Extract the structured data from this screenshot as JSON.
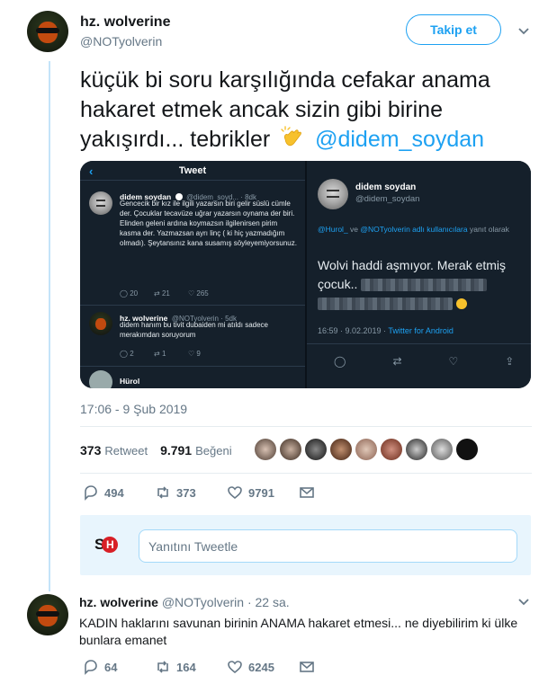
{
  "tweet": {
    "author_name": "hz. wolverine",
    "author_handle": "@NOTyolverin",
    "follow_label": "Takip et",
    "text_before": "küçük bi soru karşılığında cefakar anama hakaret etmek ancak sizin gibi birine yakışırdı... tebrikler",
    "text_mention": "@didem_soydan",
    "timestamp": "17:06 - 9 Şub 2019",
    "retweet_count": "373",
    "retweet_label": "Retweet",
    "like_count": "9.791",
    "like_label": "Beğeni",
    "actions": {
      "replies": "494",
      "retweets": "373",
      "likes": "9791"
    }
  },
  "media": {
    "left": {
      "header_title": "Tweet",
      "back_icon": "‹",
      "post1": {
        "name": "didem soydan",
        "meta": "@didem_soyd... · 8dk",
        "text": "Gencecik bir kız ile ilgili yazarsın biri gelir süslü cümle der. Çocuklar tecavüze uğrar yazarsın oynama der biri. Elinden geleni ardına koymazsın ilgilenirsen pirim kasma der. Yazmazsan ayrı linç ( ki hiç yazmadığım olmadı). Şeytansınız kana susamış söyleyemiyorsunuz.",
        "counts": [
          "20",
          "21",
          "265"
        ]
      },
      "post2": {
        "name": "hz. wolverine",
        "meta": "@NOTyolverin · 5dk",
        "text": "didem hanım bu tivit dubaiden mi atıldı sadece merakımdan soruyorum",
        "counts": [
          "2",
          "1",
          "9"
        ]
      },
      "post3_name": "Hürol"
    },
    "right": {
      "name": "didem soydan",
      "handle": "@didem_soydan",
      "reply_to_mention1": "@Hurol_",
      "reply_to_mid": "ve",
      "reply_to_mention2": "@NOTyolverin adlı kullanıcılara",
      "reply_to_suffix": "yanıt olarak",
      "text": "Wolvi haddi aşmıyor. Merak etmiş çocuk..",
      "time": "16:59 · 9.02.2019 ·",
      "source": "Twitter for Android"
    }
  },
  "reply_box": {
    "logo_s": "S",
    "logo_h": "H",
    "placeholder": "Yanıtını Tweetle"
  },
  "reply": {
    "author_name": "hz. wolverine",
    "author_handle": "@NOTyolverin",
    "time": "· 22 sa.",
    "text": "KADIN haklarını savunan birinin ANAMA hakaret etmesi... ne diyebilirim ki ülke bunlara emanet",
    "actions": {
      "replies": "64",
      "retweets": "164",
      "likes": "6245"
    }
  },
  "colors": {
    "accent": "#1da1f2",
    "text": "#14171a",
    "muted": "#657786",
    "dark_bg": "#15202b"
  },
  "icons": [
    "chevron-down-icon",
    "reply-icon",
    "retweet-icon",
    "heart-icon",
    "dm-icon",
    "clap-emoji-icon",
    "verified-icon",
    "share-icon"
  ]
}
